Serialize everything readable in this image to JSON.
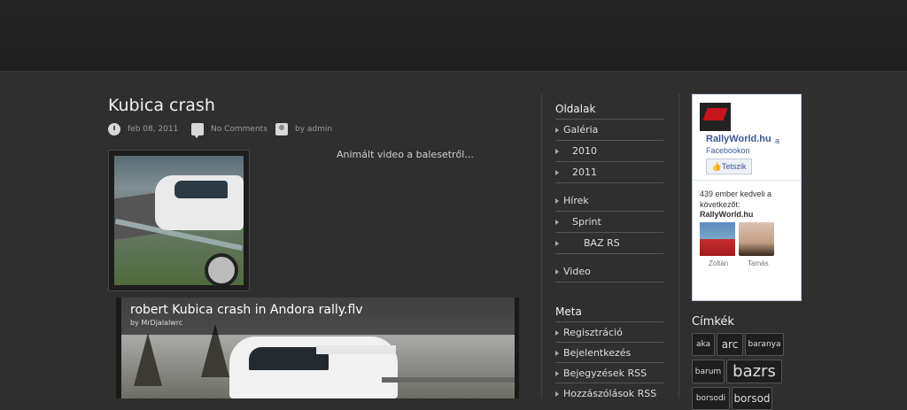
{
  "post": {
    "title": "Kubica crash",
    "date": "feb 08, 2011",
    "comments": "No Comments",
    "author": "by admin",
    "excerpt": "Animált video a balesetről...",
    "video_title": "robert Kubica crash in Andora rally.flv",
    "video_by": "by MrDjalalwrc"
  },
  "sidebar": {
    "pages_heading": "Oldalak",
    "pages": [
      {
        "label": "Galéria"
      },
      {
        "label": "2010"
      },
      {
        "label": "2011"
      },
      {
        "label": "Hírek"
      },
      {
        "label": "Sprint"
      },
      {
        "label": "BAZ RS"
      },
      {
        "label": "Video"
      }
    ],
    "meta_heading": "Meta",
    "meta": [
      {
        "label": "Regisztráció"
      },
      {
        "label": "Bejelentkezés"
      },
      {
        "label": "Bejegyzések RSS"
      },
      {
        "label": "Hozzászólások RSS"
      }
    ]
  },
  "facebook": {
    "page_name": "RallyWorld.hu",
    "suffix": "a",
    "suffix2": "Facebookon",
    "like_label": "Tetszik",
    "count_text": "439 ember kedveli a következőt:",
    "page_bold": "RallyWorld.hu",
    "fans": [
      "Zoltán",
      "Tamás"
    ]
  },
  "tags": {
    "heading": "Címkék",
    "items": [
      "aka",
      "arc",
      "baranya",
      "barum",
      "bazrs",
      "borsodi",
      "borsod"
    ]
  }
}
